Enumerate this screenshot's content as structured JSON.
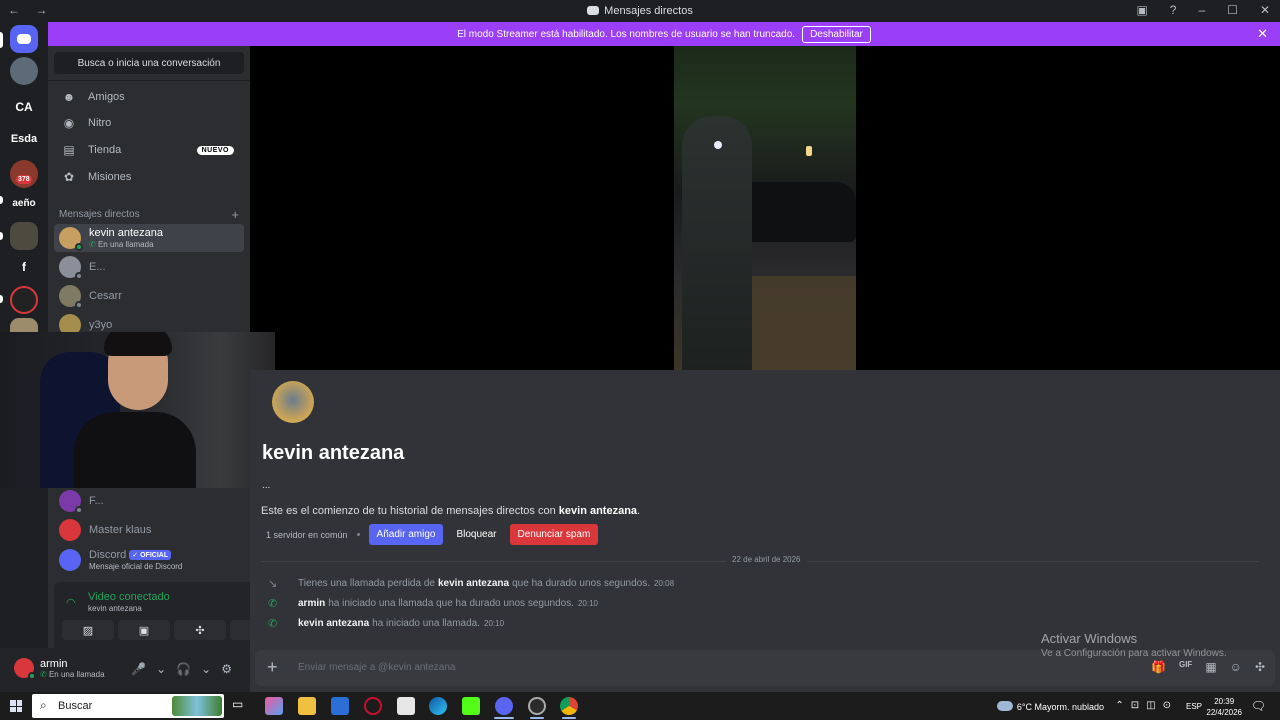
{
  "window": {
    "title": "Mensajes directos",
    "nav_arrows": "← →",
    "controls": [
      "▣",
      "?",
      "–",
      "☐",
      "✕"
    ]
  },
  "banner": {
    "text": "El modo Streamer está habilitado. Los nombres de usuario se han truncado.",
    "button": "Deshabilitar",
    "close": "✕"
  },
  "servers": [
    {
      "label": "CA"
    },
    {
      "label": "Esda"
    },
    {
      "label": "aeño"
    },
    {
      "label": "f"
    }
  ],
  "server_badge": "378",
  "sidebar": {
    "search_placeholder": "Busca o inicia una conversación",
    "nav": [
      {
        "label": "Amigos",
        "icon": "friends-icon",
        "glyph": "☻"
      },
      {
        "label": "Nitro",
        "icon": "nitro-icon",
        "glyph": "◉"
      },
      {
        "label": "Tienda",
        "icon": "shop-icon",
        "glyph": "▤",
        "badge": "NUEVO"
      },
      {
        "label": "Misiones",
        "icon": "quests-icon",
        "glyph": "✿"
      }
    ],
    "dm_header": "Mensajes directos",
    "dm_add": "+",
    "dms": [
      {
        "name": "kevin antezana",
        "status": "En una llamada",
        "active": true,
        "color": "#c7a060"
      },
      {
        "name": "E...",
        "color": "#8a8f99"
      },
      {
        "name": "Cesarr",
        "color": "#7f7a62"
      },
      {
        "name": "y3yo",
        "color": "#a58d4d"
      },
      {
        "name": "F...",
        "color": "#7a3aa8"
      },
      {
        "name": "Master klaus",
        "color": "#da373c"
      },
      {
        "name": "Discord",
        "official": "✓ OFICIAL",
        "status": "Mensaje oficial de Discord",
        "color": "#5865f2"
      }
    ]
  },
  "voice": {
    "title": "Video conectado",
    "subtitle": "kevin antezana",
    "buttons": [
      "▨",
      "▣",
      "✣",
      "✺"
    ],
    "icons": [
      "⌇",
      "☎"
    ]
  },
  "user": {
    "name": "armin",
    "status": "En una llamada",
    "controls": [
      "🎤",
      "⌄",
      "🎧",
      "⌄",
      "⚙"
    ]
  },
  "profile": {
    "name": "kevin antezana",
    "nickname": "...",
    "intro_prefix": "Este es el comienzo de tu historial de mensajes directos con",
    "intro_name": "kevin antezana",
    "intro_suffix": ".",
    "mutual": "1 servidor en común",
    "add_friend": "Añadir amigo",
    "block": "Bloquear",
    "report": "Denunciar spam"
  },
  "colors": {
    "accent": "#5865f2",
    "danger": "#da373c",
    "online": "#23a55a",
    "banner": "#9b3ef7"
  },
  "date_divider": "22 de abril de 2026",
  "messages": [
    {
      "pre": "Tienes una llamada perdida de",
      "name": "kevin antezana",
      "post": "que ha durado unos segundos.",
      "time": "20:08",
      "missed": true
    },
    {
      "pre": "",
      "name": "armin",
      "post": "ha iniciado una llamada que ha durado unos segundos.",
      "time": "20:10"
    },
    {
      "pre": "",
      "name": "kevin antezana",
      "post": "ha iniciado una llamada.",
      "time": "20:10"
    }
  ],
  "composer": {
    "placeholder": "Enviar mensaje a @kevin antezana",
    "tools": [
      "🎁",
      "GIF",
      "▦",
      "☺",
      "✣"
    ]
  },
  "activate_windows": {
    "title": "Activar Windows",
    "subtitle": "Ve a Configuración para activar Windows."
  },
  "taskbar": {
    "search": "Buscar",
    "weather": "6°C  Mayorm. nublado",
    "tray_icons": "⌃⊡◫⊙",
    "lang": "ESP",
    "time": "20:39",
    "date": "22/4/2026",
    "notification": "🗨"
  }
}
